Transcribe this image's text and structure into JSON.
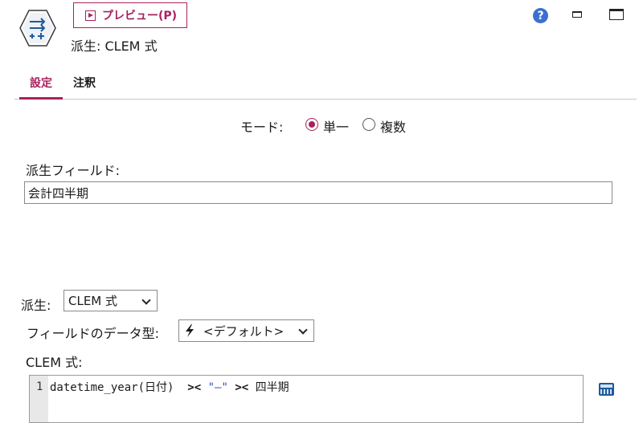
{
  "toolbar": {
    "preview_label": "プレビュー(P)",
    "node_title": "派生: CLEM 式"
  },
  "tabs": [
    {
      "label": "設定",
      "active": true
    },
    {
      "label": "注釈",
      "active": false
    }
  ],
  "mode": {
    "label": "モード:",
    "options": [
      {
        "label": "単一",
        "selected": true
      },
      {
        "label": "複数",
        "selected": false
      }
    ]
  },
  "derive_field": {
    "label": "派生フィールド:",
    "value": "会計四半期"
  },
  "derive_as": {
    "label": "派生:",
    "value": "CLEM 式"
  },
  "field_type": {
    "label": "フィールドのデータ型:",
    "value": "<デフォルト>"
  },
  "clem": {
    "label": "CLEM 式:",
    "line_number": "1",
    "code_parts": {
      "func": "datetime_year(日付)  ",
      "op1": "><",
      "space1": " ",
      "str": "\"—\"",
      "space2": " ",
      "op2": "><",
      "tail": " 四半期"
    }
  },
  "colors": {
    "accent": "#a8215f",
    "help": "#3c6fd0",
    "calculator": "#1f5a9c"
  },
  "icons": [
    "node-derive-icon",
    "play-icon",
    "help-icon",
    "minimize-icon",
    "maximize-icon",
    "chevron-down-icon",
    "lightning-icon",
    "calculator-icon"
  ]
}
